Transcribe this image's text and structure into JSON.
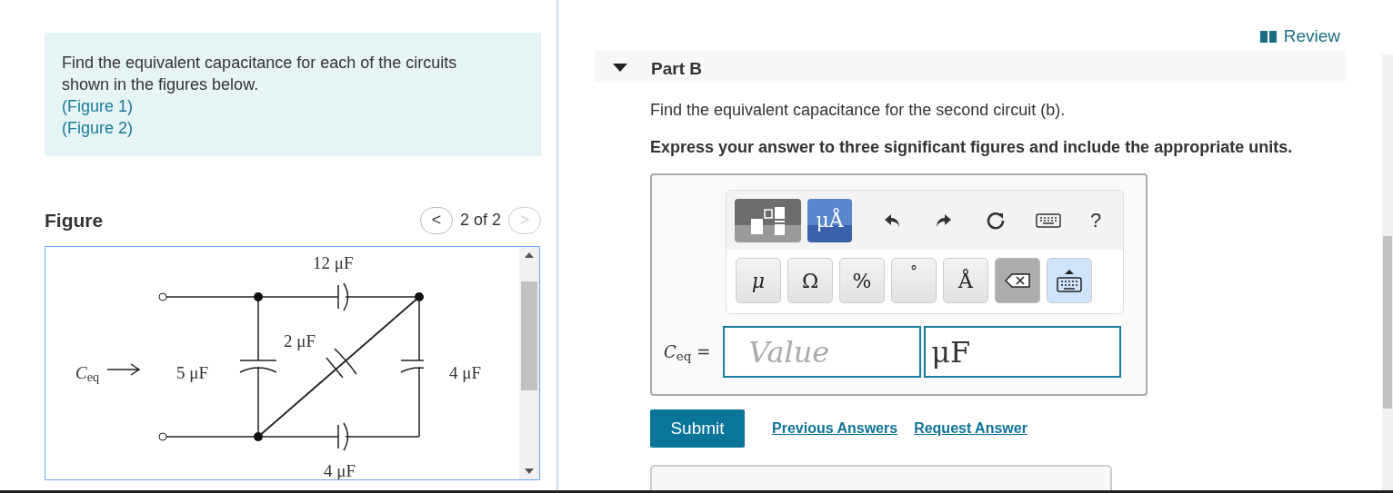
{
  "intro": {
    "text": "Find the equivalent capacitance for each of the circuits shown in the figures below.",
    "links": [
      "(Figure 1)",
      "(Figure 2)"
    ]
  },
  "figure": {
    "title": "Figure",
    "counter": "2 of 2",
    "prev": {
      "label": "<",
      "disabled": false
    },
    "next": {
      "label": ">",
      "disabled": true
    },
    "labels": [
      {
        "kind": "top",
        "text": "12 μF"
      },
      {
        "kind": "diag",
        "text": "2 μF"
      },
      {
        "kind": "left",
        "text": "5 μF"
      },
      {
        "kind": "right",
        "text": "4 μF"
      },
      {
        "kind": "bottom",
        "text": "4 μF"
      },
      {
        "kind": "ceq",
        "text": "*C*$_{eq}$"
      }
    ]
  },
  "review": "Review",
  "part": {
    "title": "Part B",
    "expanded": true
  },
  "question": "Find the equivalent capacitance for the second circuit (b).",
  "instruction": "Express your answer to three significant figures and include the appropriate units.",
  "toolbar": [
    {
      "kind": "templates",
      "selected": false
    },
    {
      "kind": "units",
      "label": "μÅ",
      "selected": true
    },
    {
      "kind": "undo"
    },
    {
      "kind": "redo"
    },
    {
      "kind": "reset"
    },
    {
      "kind": "keyboard"
    },
    {
      "kind": "help",
      "label": "?"
    }
  ],
  "keys": [
    {
      "kind": "char",
      "label": "μ",
      "italic": true
    },
    {
      "kind": "char",
      "label": "Ω",
      "italic": false
    },
    {
      "kind": "char",
      "label": "%",
      "italic": false
    },
    {
      "kind": "degree",
      "label": "°"
    },
    {
      "kind": "char",
      "label": "Å",
      "italic": false
    },
    {
      "kind": "backspace"
    },
    {
      "kind": "keyboard"
    }
  ],
  "answer": {
    "label": "*C*$_{eq}$ =",
    "placeholder": "Value",
    "unit": "μF"
  },
  "actions": {
    "submit": "Submit",
    "links": [
      "Previous Answers",
      "Request Answer"
    ]
  }
}
